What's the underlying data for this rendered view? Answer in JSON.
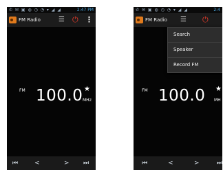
{
  "status_bar": {
    "left": "✆ ✉ ▣ ◍ ◷ ◔ ▾ ◢ ◢",
    "time": "2:47 PM",
    "time_short": "2:4"
  },
  "app": {
    "title": "FM Radio",
    "list_icon": "☰",
    "power_icon": "⏻",
    "menu_icon": "⋮"
  },
  "tuner": {
    "band": "FM",
    "frequency": "100.0",
    "unit": "MHz",
    "unit_short": "MH",
    "star": "★"
  },
  "controls": {
    "prev_station": "⏮",
    "seek_down": "<",
    "seek_up": ">",
    "next_station": "⏭"
  },
  "overflow_menu": [
    {
      "label": "Search"
    },
    {
      "label": "Speaker"
    },
    {
      "label": "Record FM"
    }
  ],
  "colors": {
    "accent": "#e07a1c",
    "power": "#e53a2a",
    "background": "#050505",
    "status_time": "#4aa8e0"
  }
}
